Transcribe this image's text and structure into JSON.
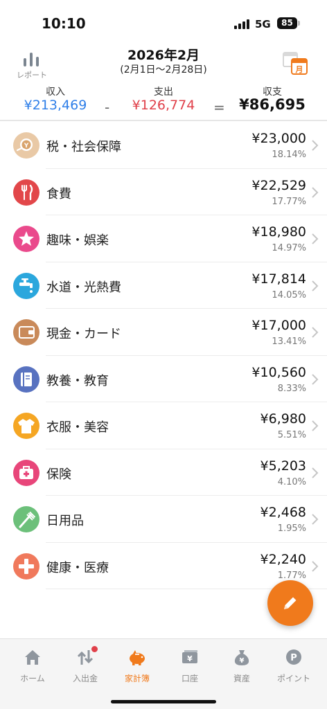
{
  "status": {
    "time": "10:10",
    "network": "5G",
    "battery": "85"
  },
  "header": {
    "report_label": "レポート",
    "month_title": "2026年2月",
    "date_range": "(2月1日〜2月28日)",
    "calendar_icon_text": "月"
  },
  "summary": {
    "income_label": "収入",
    "income_value": "¥213,469",
    "expense_label": "支出",
    "expense_value": "¥126,774",
    "balance_label": "収支",
    "balance_value": "¥86,695",
    "minus": "-",
    "equals": "=",
    "colors": {
      "income": "#2f7fe8",
      "expense": "#e0404a",
      "balance": "#111111"
    }
  },
  "categories": [
    {
      "name": "税・社会保障",
      "amount": "¥23,000",
      "percent": "18.14%",
      "icon": "coin-hand-icon",
      "color": "#e9c9a6"
    },
    {
      "name": "食費",
      "amount": "¥22,529",
      "percent": "17.77%",
      "icon": "fork-knife-icon",
      "color": "#e2474a"
    },
    {
      "name": "趣味・娯楽",
      "amount": "¥18,980",
      "percent": "14.97%",
      "icon": "star-icon",
      "color": "#ea4a8c"
    },
    {
      "name": "水道・光熱費",
      "amount": "¥17,814",
      "percent": "14.05%",
      "icon": "faucet-icon",
      "color": "#2ba7dd"
    },
    {
      "name": "現金・カード",
      "amount": "¥17,000",
      "percent": "13.41%",
      "icon": "wallet-icon",
      "color": "#c98a5a"
    },
    {
      "name": "教養・教育",
      "amount": "¥10,560",
      "percent": "8.33%",
      "icon": "book-icon",
      "color": "#5872c0"
    },
    {
      "name": "衣服・美容",
      "amount": "¥6,980",
      "percent": "5.51%",
      "icon": "tshirt-icon",
      "color": "#f5a623"
    },
    {
      "name": "保険",
      "amount": "¥5,203",
      "percent": "4.10%",
      "icon": "medical-bag-icon",
      "color": "#e8467a"
    },
    {
      "name": "日用品",
      "amount": "¥2,468",
      "percent": "1.95%",
      "icon": "toothbrush-icon",
      "color": "#6cc07a"
    },
    {
      "name": "健康・医療",
      "amount": "¥2,240",
      "percent": "1.77%",
      "icon": "plus-cross-icon",
      "color": "#f0795c"
    }
  ],
  "tabs": [
    {
      "label": "ホーム",
      "icon": "home-icon",
      "active": false
    },
    {
      "label": "入出金",
      "icon": "arrows-updown-icon",
      "active": false,
      "badge": true
    },
    {
      "label": "家計簿",
      "icon": "piggy-bank-icon",
      "active": true
    },
    {
      "label": "口座",
      "icon": "bank-card-icon",
      "active": false
    },
    {
      "label": "資産",
      "icon": "money-bag-icon",
      "active": false
    },
    {
      "label": "ポイント",
      "icon": "point-icon",
      "active": false
    }
  ],
  "tab_icon_text": {
    "yen": "¥",
    "point": "P"
  },
  "accent_color": "#f07a1c"
}
